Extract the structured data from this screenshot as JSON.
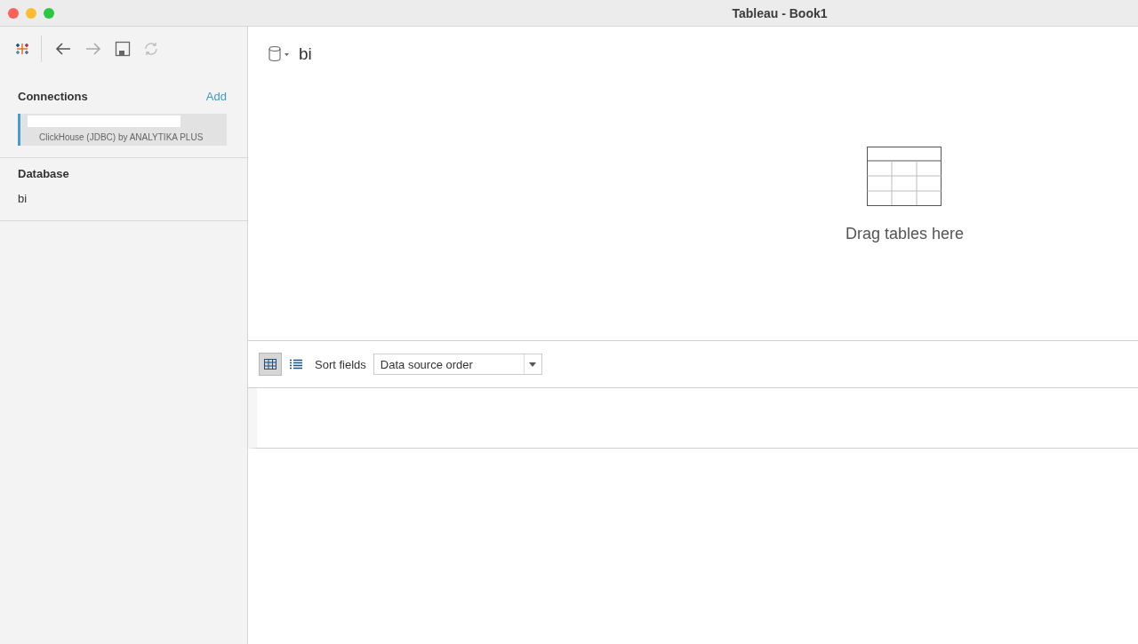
{
  "window": {
    "title": "Tableau - Book1"
  },
  "sidebar": {
    "connections_heading": "Connections",
    "add_link": "Add",
    "connections": [
      {
        "subtitle": "ClickHouse (JDBC) by ANALYTIKA PLUS",
        "selected": true
      }
    ],
    "database_heading": "Database",
    "database": "bi"
  },
  "canvas": {
    "datasource_name": "bi",
    "drop_hint": "Drag tables here"
  },
  "grid_toolbar": {
    "view_modes": [
      {
        "kind": "grid",
        "selected": true
      },
      {
        "kind": "list",
        "selected": false
      }
    ],
    "sort_label": "Sort fields",
    "sort_value": "Data source order"
  }
}
